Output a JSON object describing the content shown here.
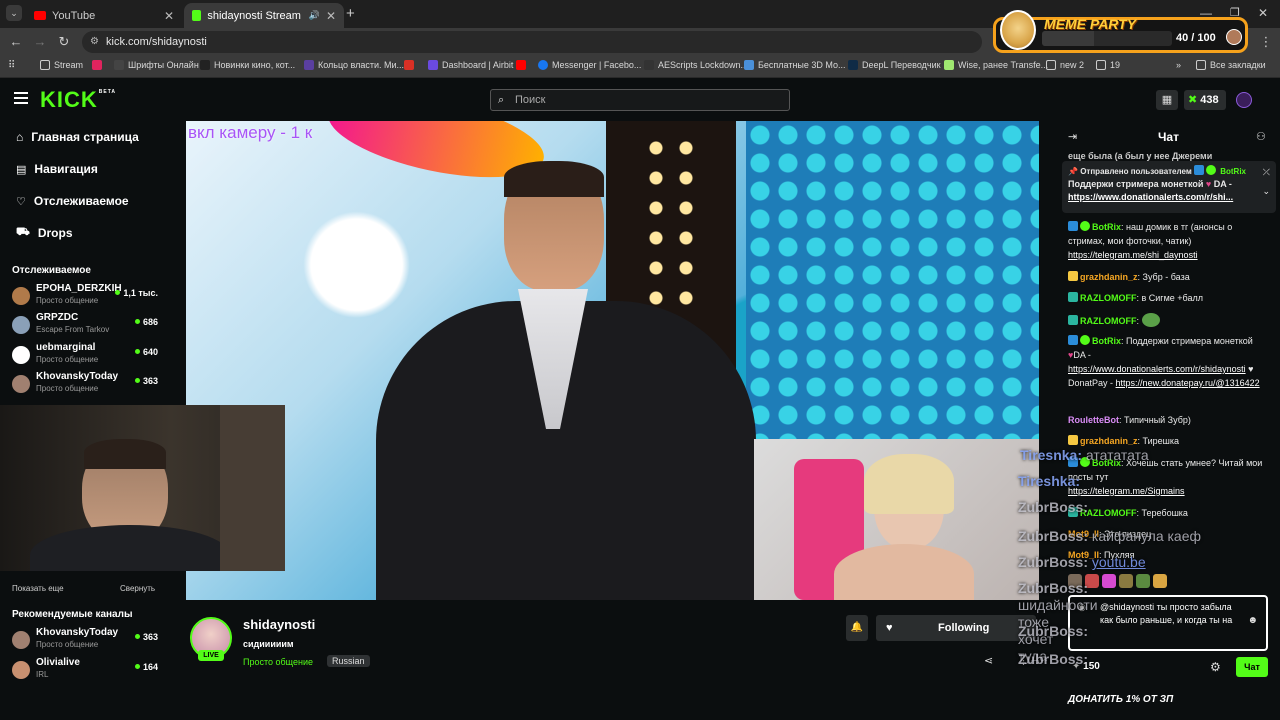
{
  "browser": {
    "tabs": [
      {
        "title": "YouTube"
      },
      {
        "title": "shidaynosti Stream - Watch"
      }
    ],
    "url": "kick.com/shidaynosti",
    "bookmarks": [
      "Stream",
      "Шрифты Онлайн",
      "Новинки кино, кот...",
      "Кольцо власти. Ми...",
      "Dashboard | Airbit",
      "Messenger | Facebo...",
      "AEScripts Lockdown...",
      "Бесплатные 3D Мо...",
      "DeepL Переводчик",
      "Wise, ранее Transfe...",
      "new 2",
      "19"
    ],
    "all_bookmarks": "Все закладки"
  },
  "meme_party": {
    "title": "MEME PARTY",
    "progress": "40 / 100",
    "progress_value": 0.4
  },
  "kick": {
    "logo": "KICK",
    "logo_sup": "BETA",
    "search_placeholder": "Поиск",
    "coins": "438"
  },
  "sidebar": {
    "nav": [
      {
        "label": "Главная страница",
        "icon": "home-icon"
      },
      {
        "label": "Навигация",
        "icon": "browse-icon"
      },
      {
        "label": "Отслеживаемое",
        "icon": "heart-icon"
      },
      {
        "label": "Drops",
        "icon": "drops-icon"
      }
    ],
    "following_header": "Отслеживаемое",
    "following": [
      {
        "name": "EPOHA_DERZKIH",
        "category": "Просто общение",
        "viewers": "1,1 тыс.",
        "color": "#b07a4a"
      },
      {
        "name": "GRPZDC",
        "category": "Escape From Tarkov",
        "viewers": "686",
        "color": "#8aa0b8"
      },
      {
        "name": "uebmarginal",
        "category": "Просто общение",
        "viewers": "640",
        "color": "#ffffff"
      },
      {
        "name": "KhovanskyToday",
        "category": "Просто общение",
        "viewers": "363",
        "color": "#a08070"
      }
    ],
    "show_more": "Показать еще",
    "collapse": "Свернуть",
    "recommended_header": "Рекомендуемые каналы",
    "recommended": [
      {
        "name": "KhovanskyToday",
        "category": "Просто общение",
        "viewers": "363",
        "color": "#a08070"
      },
      {
        "name": "Olivialive",
        "category": "IRL",
        "viewers": "164",
        "color": "#c89070"
      }
    ]
  },
  "stream": {
    "overlay_text": "вкл камеру - 1 к",
    "channel": "shidaynosti",
    "title": "сидииииим",
    "category": "Просто общение",
    "language": "Russian",
    "live": "LIVE",
    "follow_label": "Following"
  },
  "chat": {
    "title": "Чат",
    "pinned_by": "Отправлено пользователем",
    "pinned_user": "BotRix",
    "pinned_text": "Поддержи стримера монеткой",
    "pinned_tail": "DA -",
    "pinned_link": "https://www.donationalerts.com/r/shi...",
    "top_cut": "еще была (а был у нее Джереми",
    "messages": [
      {
        "user": "BotRix",
        "color": "#53fc18",
        "text": ": наш домик в тг (анонсы о стримах, мои фоточки, чатик)",
        "link": "https://telegram.me/shi_daynosti"
      },
      {
        "user": "grazhdanin_z",
        "color": "#f5a623",
        "text": ": Зубр - база"
      },
      {
        "user": "RAZLOMOFF",
        "color": "#53fc18",
        "text": ": в Сигме +балл"
      },
      {
        "user": "RAZLOMOFF",
        "color": "#53fc18",
        "text": ":"
      },
      {
        "user": "BotRix",
        "color": "#53fc18",
        "text": ": Поддержи стримера монеткой",
        "text2": "DA -",
        "link": "https://www.donationalerts.com/r/shidaynosti",
        "text3": "DonatPay -",
        "link2": "https://new.donatepay.ru/@1316422"
      },
      {
        "user": "RouletteBot",
        "color": "#d98cf5",
        "text": ": Типичный Зубр)"
      },
      {
        "user": "grazhdanin_z",
        "color": "#f5a623",
        "text": ": Тирешка"
      },
      {
        "user": "BotRix",
        "color": "#53fc18",
        "text": ": Хочешь стать умнее? Читай мои посты тут",
        "link": "https://telegram.me/Sigmains"
      },
      {
        "user": "RAZLOMOFF",
        "color": "#53fc18",
        "text": ": Теребошка"
      },
      {
        "user": "Mot9_II",
        "color": "#f5a623",
        "text": ": Это пиздец"
      },
      {
        "user": "Mot9_II",
        "color": "#f5a623",
        "text": ": Пухляя"
      }
    ],
    "overlay_names": [
      {
        "name": "Tiresnka:",
        "text": "атататата"
      },
      {
        "name": "Tireshka:",
        "text": ""
      },
      {
        "name": "ZubrBoss:",
        "text": ""
      },
      {
        "name": "ZubrBoss:",
        "text": "кайфанула каеф"
      },
      {
        "name": "ZubrBoss:",
        "text": "youtu.be"
      },
      {
        "name": "ZubrBoss:",
        "text": "шидайности тоже хочет туда"
      },
      {
        "name": "ZubrBoss:",
        "text": ""
      },
      {
        "name": "ZubrBoss:",
        "text": ""
      }
    ],
    "input_text": "@shidaynosti ты просто забыла как было раньше, и когда ты на",
    "points": "150",
    "send": "Чат"
  },
  "bottom_banner": "ДОНАТИТЬ 1% ОТ ЗП"
}
